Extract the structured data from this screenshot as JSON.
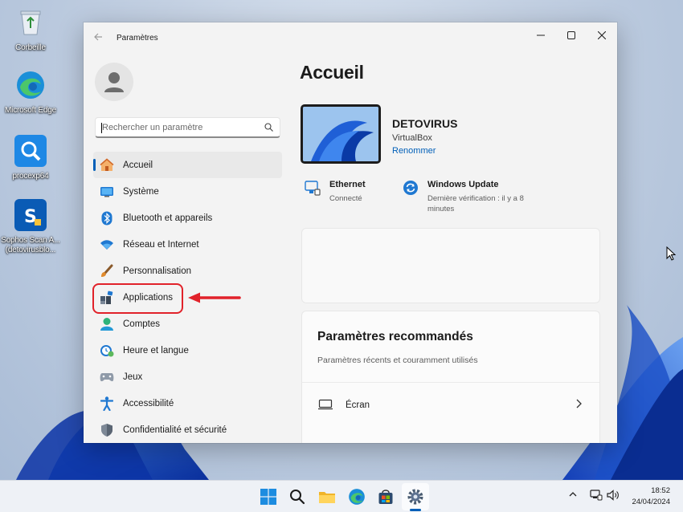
{
  "desktop": {
    "icons": [
      {
        "label": "Corbeille",
        "icon": "recycle-bin-icon"
      },
      {
        "label": "Microsoft Edge",
        "icon": "edge-icon"
      },
      {
        "label": "procexp64",
        "icon": "process-explorer-icon"
      },
      {
        "label": "Sophos Scan A...",
        "label2": "(detovirusblo...",
        "icon": "sophos-icon"
      }
    ]
  },
  "window": {
    "title": "Paramètres",
    "controls": {
      "minimize": "minimize-icon",
      "maximize": "maximize-icon",
      "close": "close-icon"
    }
  },
  "sidebar": {
    "search_placeholder": "Rechercher un paramètre",
    "items": [
      {
        "label": "Accueil",
        "icon": "home-icon",
        "active": true
      },
      {
        "label": "Système",
        "icon": "system-icon"
      },
      {
        "label": "Bluetooth et appareils",
        "icon": "bluetooth-icon"
      },
      {
        "label": "Réseau et Internet",
        "icon": "wifi-icon"
      },
      {
        "label": "Personnalisation",
        "icon": "brush-icon"
      },
      {
        "label": "Applications",
        "icon": "apps-icon"
      },
      {
        "label": "Comptes",
        "icon": "account-icon"
      },
      {
        "label": "Heure et langue",
        "icon": "clock-globe-icon"
      },
      {
        "label": "Jeux",
        "icon": "gamepad-icon"
      },
      {
        "label": "Accessibilité",
        "icon": "accessibility-icon"
      },
      {
        "label": "Confidentialité et sécurité",
        "icon": "shield-icon"
      }
    ]
  },
  "main": {
    "title": "Accueil",
    "device": {
      "name": "DETOVIRUS",
      "model": "VirtualBox",
      "rename": "Renommer"
    },
    "status": {
      "network": {
        "title": "Ethernet",
        "subtitle": "Connecté"
      },
      "update": {
        "title": "Windows Update",
        "subtitle1": "Dernière vérification : il y a 8",
        "subtitle2": "minutes"
      }
    },
    "recommended": {
      "title": "Paramètres recommandés",
      "subtitle": "Paramètres récents et couramment utilisés",
      "rows": [
        {
          "label": "Écran",
          "icon": "monitor-icon"
        }
      ]
    }
  },
  "taskbar": {
    "apps": [
      "start-icon",
      "search-icon",
      "file-explorer-icon",
      "edge-icon",
      "store-icon",
      "settings-icon"
    ],
    "time": "18:52",
    "date": "24/04/2024"
  },
  "colors": {
    "accent": "#005fb8",
    "highlight": "#e1222a"
  }
}
